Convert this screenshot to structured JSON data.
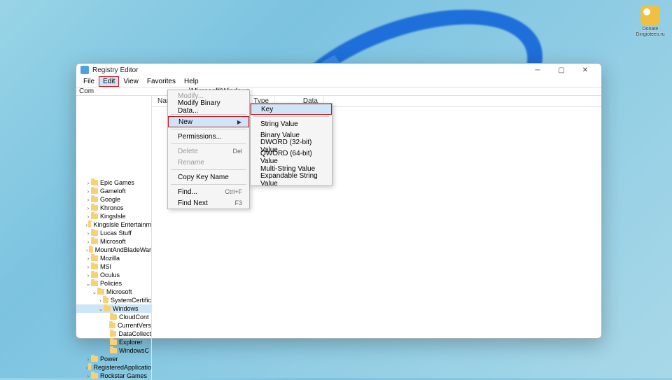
{
  "desktop": {
    "icon_label": "Donate\nDingiotees.ru"
  },
  "window": {
    "title": "Registry Editor",
    "menubar": [
      "File",
      "Edit",
      "View",
      "Favorites",
      "Help"
    ],
    "active_menu_index": 1,
    "address_prefix": "Com",
    "address_tail": "\\Microsoft\\Windows",
    "columns": {
      "name": "Name",
      "type": "Type",
      "data": "Data"
    },
    "row_data_hint": "ue not set)"
  },
  "tree": [
    {
      "d": 1,
      "e": ">",
      "l": "Epic Games"
    },
    {
      "d": 1,
      "e": ">",
      "l": "Gameloft"
    },
    {
      "d": 1,
      "e": ">",
      "l": "Google"
    },
    {
      "d": 1,
      "e": ">",
      "l": "Khronos"
    },
    {
      "d": 1,
      "e": ">",
      "l": "KingsIsle"
    },
    {
      "d": 1,
      "e": ">",
      "l": "KingsIsle Entertainm"
    },
    {
      "d": 1,
      "e": ">",
      "l": "Lucas Stuff"
    },
    {
      "d": 1,
      "e": ">",
      "l": "Microsoft"
    },
    {
      "d": 1,
      "e": ">",
      "l": "MountAndBladeWar"
    },
    {
      "d": 1,
      "e": ">",
      "l": "Mozilla"
    },
    {
      "d": 1,
      "e": ">",
      "l": "MSI"
    },
    {
      "d": 1,
      "e": ">",
      "l": "Oculus"
    },
    {
      "d": 1,
      "e": "v",
      "l": "Policies"
    },
    {
      "d": 2,
      "e": "v",
      "l": "Microsoft"
    },
    {
      "d": 3,
      "e": ">",
      "l": "SystemCertific"
    },
    {
      "d": 3,
      "e": "v",
      "l": "Windows",
      "sel": true
    },
    {
      "d": 4,
      "e": "",
      "l": "CloudCont"
    },
    {
      "d": 4,
      "e": "",
      "l": "CurrentVers"
    },
    {
      "d": 4,
      "e": "",
      "l": "DataCollect"
    },
    {
      "d": 4,
      "e": "",
      "l": "Explorer"
    },
    {
      "d": 4,
      "e": "",
      "l": "WindowsC"
    },
    {
      "d": 1,
      "e": ">",
      "l": "Power"
    },
    {
      "d": 1,
      "e": ">",
      "l": "RegisteredApplicatio"
    },
    {
      "d": 1,
      "e": ">",
      "l": "Rockstar Games"
    }
  ],
  "edit_menu": {
    "modify": "Modify...",
    "modify_binary": "Modify Binary Data...",
    "new": "New",
    "permissions": "Permissions...",
    "delete": "Delete",
    "delete_sc": "Del",
    "rename": "Rename",
    "copy_key": "Copy Key Name",
    "find": "Find...",
    "find_sc": "Ctrl+F",
    "find_next": "Find Next",
    "find_next_sc": "F3"
  },
  "new_submenu": {
    "key": "Key",
    "string": "String Value",
    "binary": "Binary Value",
    "dword": "DWORD (32-bit) Value",
    "qword": "QWORD (64-bit) Value",
    "multi": "Multi-String Value",
    "expand": "Expandable String Value"
  }
}
